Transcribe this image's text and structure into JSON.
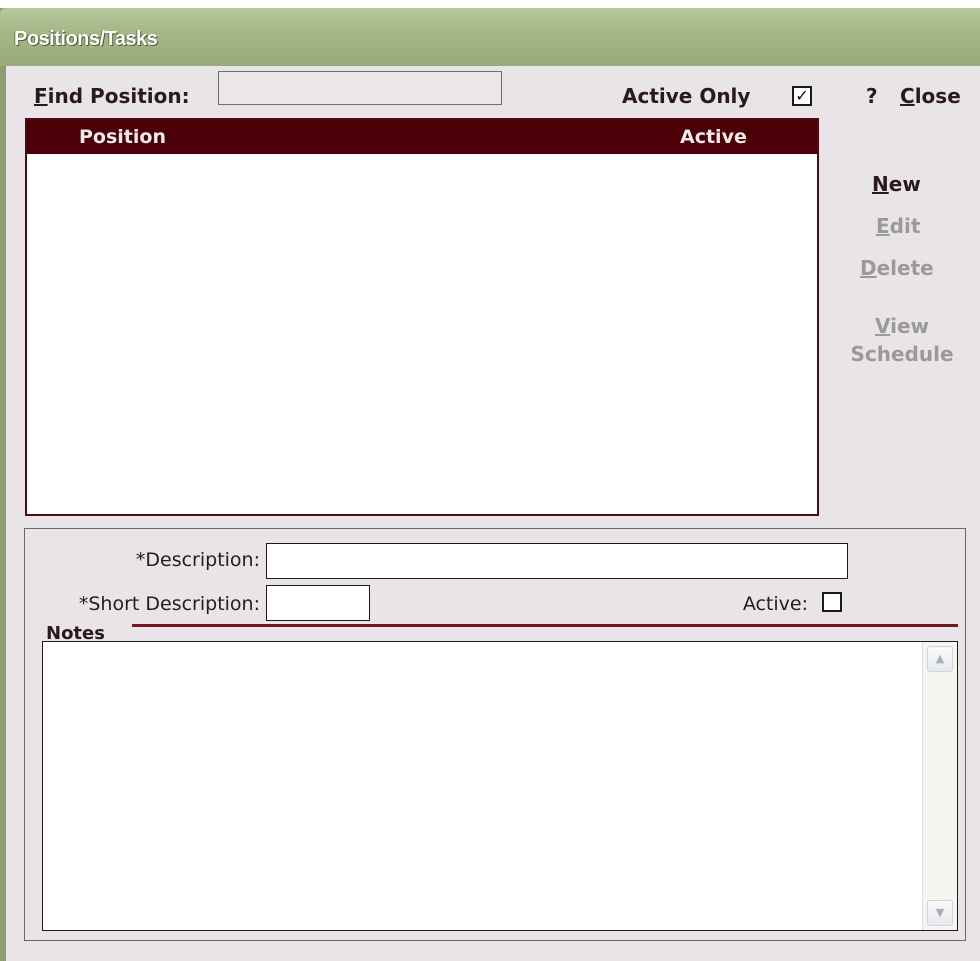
{
  "window": {
    "title": "Positions/Tasks"
  },
  "toolbar": {
    "find_label_first": "F",
    "find_label_rest": "ind Position:",
    "find_value": "",
    "active_only_label": "Active Only",
    "active_only_checked": true,
    "help_label": "?",
    "close_label_first": "C",
    "close_label_rest": "lose"
  },
  "grid": {
    "columns": [
      "Position",
      "Active"
    ],
    "rows": []
  },
  "actions": {
    "new_first": "N",
    "new_rest": "ew",
    "edit_first": "E",
    "edit_rest": "dit",
    "delete_first": "D",
    "delete_rest": "elete",
    "view_first": "V",
    "view_rest": "iew",
    "schedule": "Schedule"
  },
  "detail": {
    "description_label": "*Description:",
    "description_value": "",
    "short_description_label": "*Short Description:",
    "short_description_value": "",
    "active_label": "Active:",
    "active_checked": false,
    "notes_label": "Notes",
    "notes_value": ""
  },
  "colors": {
    "title_bar": "#a3b685",
    "grid_header": "#4a0006",
    "background": "#e9e4e7",
    "disabled_text": "#9a9a9a"
  },
  "icons": {
    "scroll_up": "scroll-up-arrow-icon",
    "scroll_down": "scroll-down-arrow-icon"
  }
}
